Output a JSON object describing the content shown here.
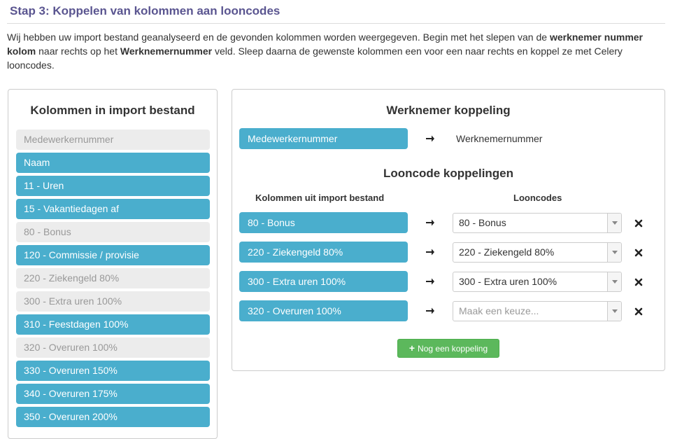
{
  "page": {
    "title": "Stap 3: Koppelen van kolommen aan looncodes",
    "intro": {
      "part1": "Wij hebben uw import bestand geanalyseerd en de gevonden kolommen worden weergegeven. Begin met het slepen van de ",
      "bold1": "werknemer nummer kolom",
      "part2": " naar rechts op het ",
      "bold2": "Werknemernummer",
      "part3": " veld. Sleep daarna de gewenste kolommen een voor een naar rechts en koppel ze met Celery looncodes."
    }
  },
  "import_columns": {
    "heading": "Kolommen in import bestand",
    "items": [
      {
        "label": "Medewerkernummer",
        "state": "used"
      },
      {
        "label": "Naam",
        "state": "active"
      },
      {
        "label": "11 - Uren",
        "state": "active"
      },
      {
        "label": "15 - Vakantiedagen af",
        "state": "active"
      },
      {
        "label": "80 - Bonus",
        "state": "used"
      },
      {
        "label": "120 - Commissie / provisie",
        "state": "active"
      },
      {
        "label": "220 - Ziekengeld 80%",
        "state": "used"
      },
      {
        "label": "300 - Extra uren 100%",
        "state": "used"
      },
      {
        "label": "310 - Feestdagen 100%",
        "state": "active"
      },
      {
        "label": "320 - Overuren 100%",
        "state": "used"
      },
      {
        "label": "330 - Overuren 150%",
        "state": "active"
      },
      {
        "label": "340 - Overuren 175%",
        "state": "active"
      },
      {
        "label": "350 - Overuren 200%",
        "state": "active"
      }
    ]
  },
  "employee_mapping": {
    "heading": "Werknemer koppeling",
    "source": "Medewerkernummer",
    "target": "Werknemernummer"
  },
  "wage_mapping": {
    "heading": "Looncode koppelingen",
    "col_source_header": "Kolommen uit import bestand",
    "col_target_header": "Looncodes",
    "rows": [
      {
        "source": "80 - Bonus",
        "target": "80 - Bonus",
        "placeholder": false
      },
      {
        "source": "220 - Ziekengeld 80%",
        "target": "220 - Ziekengeld 80%",
        "placeholder": false
      },
      {
        "source": "300 - Extra uren 100%",
        "target": "300 - Extra uren 100%",
        "placeholder": false
      },
      {
        "source": "320 - Overuren 100%",
        "target": "Maak een keuze...",
        "placeholder": true
      }
    ],
    "add_button": "Nog een koppeling"
  },
  "colors": {
    "accent_blue": "#4aaecd",
    "used_gray": "#ececec",
    "title_purple": "#5a5590",
    "add_green": "#5cb85c"
  },
  "icons": {
    "arrow": "arrow-right-icon",
    "remove": "close-icon",
    "dropdown": "chevron-down-icon",
    "add": "plus-icon"
  }
}
